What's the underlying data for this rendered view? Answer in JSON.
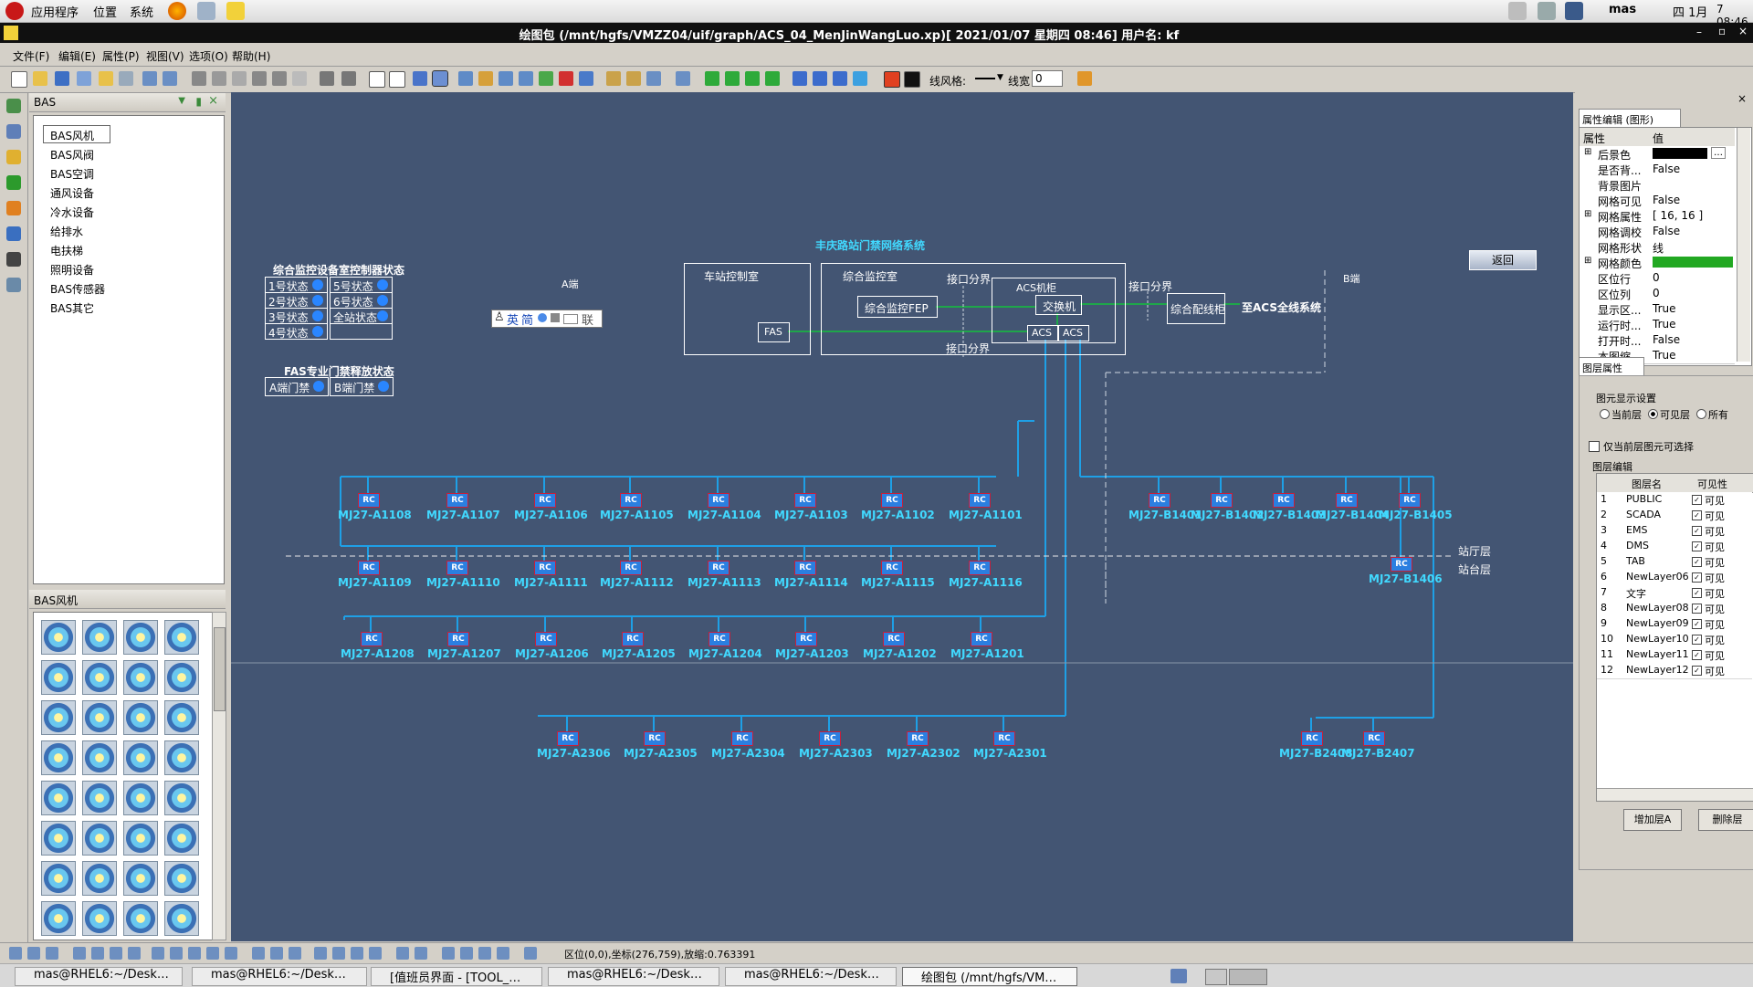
{
  "system_bar": {
    "menu_apps": "应用程序",
    "menu_places": "位置",
    "menu_system": "系统",
    "user": "mas",
    "date": "四 1月",
    "time": "7 08:46"
  },
  "window": {
    "title": "绘图包 (/mnt/hgfs/VMZZ04/uif/graph/ACS_04_MenJinWangLuo.xp)[ 2021/01/07 星期四 08:46]  用户名: kf",
    "controls": [
      "–",
      "▫",
      "×"
    ]
  },
  "menu": [
    "文件(F)",
    "编辑(E)",
    "属性(P)",
    "视图(V)",
    "选项(O)",
    "帮助(H)"
  ],
  "toolbar": {
    "line_style_label": "线风格:",
    "line_width_label": "线宽",
    "line_width_value": "0"
  },
  "tree_panel": {
    "title": "BAS",
    "items": [
      "BAS风机",
      "BAS风阀",
      "BAS空调",
      "通风设备",
      "冷水设备",
      "给排水",
      "电扶梯",
      "照明设备",
      "BAS传感器",
      "BAS其它"
    ],
    "selected": "BAS风机"
  },
  "palette_panel": {
    "title": "BAS风机"
  },
  "canvas": {
    "title": "丰庆路站门禁网络系统",
    "return_button": "返回",
    "status_title": "综合监控设备室控制器状态",
    "status_cells": [
      "1号状态",
      "5号状态",
      "2号状态",
      "6号状态",
      "3号状态",
      "全站状态",
      "4号状态"
    ],
    "fas_title": "FAS专业门禁释放状态",
    "fas_cells": [
      "A端门禁",
      "B端门禁"
    ],
    "ime": {
      "lang": "英",
      "mode": "简",
      "suffix": "联"
    },
    "a_end": "A端",
    "b_end": "B端",
    "station_control": "车站控制室",
    "fas": "FAS",
    "integrated_monitor": "综合监控室",
    "fep": "综合监控FEP",
    "acs_cabinet": "ACS机柜",
    "switch": "交换机",
    "acs1": "ACS",
    "acs2": "ACS",
    "iface_top": "接口分界",
    "iface_bottom": "接口分界",
    "iface_right": "接口分界",
    "patch": "综合配线柜",
    "to_line": "至ACS全线系统",
    "hall": "站厅层",
    "platform": "站台层",
    "rc_text": "RC",
    "row1": [
      "MJ27-A1108",
      "MJ27-A1107",
      "MJ27-A1106",
      "MJ27-A1105",
      "MJ27-A1104",
      "MJ27-A1103",
      "MJ27-A1102",
      "MJ27-A1101"
    ],
    "row2": [
      "MJ27-A1109",
      "MJ27-A1110",
      "MJ27-A1111",
      "MJ27-A1112",
      "MJ27-A1113",
      "MJ27-A1114",
      "MJ27-A1115",
      "MJ27-A1116"
    ],
    "row3": [
      "MJ27-A1208",
      "MJ27-A1207",
      "MJ27-A1206",
      "MJ27-A1205",
      "MJ27-A1204",
      "MJ27-A1203",
      "MJ27-A1202",
      "MJ27-A1201"
    ],
    "row4": [
      "MJ27-A2306",
      "MJ27-A2305",
      "MJ27-A2304",
      "MJ27-A2303",
      "MJ27-A2302",
      "MJ27-A2301"
    ],
    "brow": [
      "MJ27-B1401",
      "MJ27-B1402",
      "MJ27-B1403",
      "MJ27-B1404",
      "MJ27-B1405"
    ],
    "b1406": "MJ27-B1406",
    "bbottom": [
      "MJ27-B2408",
      "MJ27-B2407"
    ]
  },
  "properties": {
    "tab": "属性编辑 (图形)",
    "col_prop": "属性",
    "col_value": "值",
    "rows": [
      {
        "k": "后景色",
        "v": "",
        "expand": true
      },
      {
        "k": "是否背...",
        "v": "False"
      },
      {
        "k": "背景图片",
        "v": ""
      },
      {
        "k": "网格可见",
        "v": "False"
      },
      {
        "k": "网格属性",
        "v": "[ 16, 16 ]",
        "expand": true
      },
      {
        "k": "网格调校",
        "v": "False"
      },
      {
        "k": "网格形状",
        "v": "线"
      },
      {
        "k": "网格颜色",
        "v": "",
        "expand": true
      },
      {
        "k": "区位行",
        "v": "0"
      },
      {
        "k": "区位列",
        "v": "0"
      },
      {
        "k": "显示区...",
        "v": "True"
      },
      {
        "k": "运行时...",
        "v": "True"
      },
      {
        "k": "打开时...",
        "v": "False"
      },
      {
        "k": "本图缩...",
        "v": "True"
      }
    ],
    "bg_color": "#000000",
    "grid_color": "#22a822"
  },
  "layers": {
    "tab": "图层属性",
    "display_group": "图元显示设置",
    "radio_current": "当前层",
    "radio_visible": "可见层",
    "radio_all": "所有",
    "only_current": "仅当前层图元可选择",
    "edit_group": "图层编辑",
    "col_name": "图层名",
    "col_visible": "可见性",
    "visible_text": "可见",
    "rows": [
      {
        "n": "1",
        "name": "PUBLIC"
      },
      {
        "n": "2",
        "name": "SCADA"
      },
      {
        "n": "3",
        "name": "EMS"
      },
      {
        "n": "4",
        "name": "DMS"
      },
      {
        "n": "5",
        "name": "TAB"
      },
      {
        "n": "6",
        "name": "NewLayer06"
      },
      {
        "n": "7",
        "name": "文字"
      },
      {
        "n": "8",
        "name": "NewLayer08"
      },
      {
        "n": "9",
        "name": "NewLayer09"
      },
      {
        "n": "10",
        "name": "NewLayer10"
      },
      {
        "n": "11",
        "name": "NewLayer11"
      },
      {
        "n": "12",
        "name": "NewLayer12"
      }
    ],
    "add_button": "增加层A",
    "delete_button": "删除层"
  },
  "status": {
    "text": "区位(0,0),坐标(276,759),放缩:0.763391"
  },
  "taskbar": {
    "tasks": [
      "mas@RHEL6:~/Desk…",
      "mas@RHEL6:~/Desk…",
      "[值班员界面 - [TOOL_…",
      "mas@RHEL6:~/Desk…",
      "mas@RHEL6:~/Desk…",
      "绘图包 (/mnt/hgfs/VM…"
    ]
  },
  "colors": {
    "canvas_bg": "#435573",
    "cyan": "#41d9ff",
    "link": "#1ea0e6",
    "green": "#1fa64a"
  }
}
